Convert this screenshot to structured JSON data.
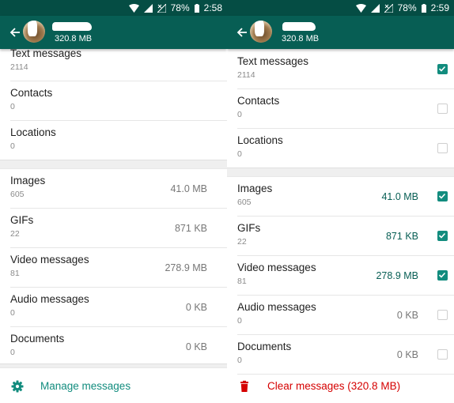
{
  "left_screen": {
    "status_bar": {
      "battery": "78%",
      "time": "2:58"
    },
    "toolbar": {
      "subtitle": "320.8 MB"
    },
    "groups": [
      [
        {
          "title": "Text messages",
          "count": "2114",
          "size": ""
        },
        {
          "title": "Contacts",
          "count": "0",
          "size": ""
        },
        {
          "title": "Locations",
          "count": "0",
          "size": ""
        }
      ],
      [
        {
          "title": "Images",
          "count": "605",
          "size": "41.0 MB"
        },
        {
          "title": "GIFs",
          "count": "22",
          "size": "871 KB"
        },
        {
          "title": "Video messages",
          "count": "81",
          "size": "278.9 MB"
        },
        {
          "title": "Audio messages",
          "count": "0",
          "size": "0 KB"
        },
        {
          "title": "Documents",
          "count": "0",
          "size": "0 KB"
        }
      ]
    ],
    "action": {
      "label": "Manage messages",
      "icon": "gear-icon",
      "color": "#128c7e"
    }
  },
  "right_screen": {
    "status_bar": {
      "battery": "78%",
      "time": "2:59"
    },
    "toolbar": {
      "subtitle": "320.8 MB"
    },
    "groups": [
      [
        {
          "title": "Text messages",
          "count": "2114",
          "size": "",
          "checked": true
        },
        {
          "title": "Contacts",
          "count": "0",
          "size": "",
          "checked": false
        },
        {
          "title": "Locations",
          "count": "0",
          "size": "",
          "checked": false
        }
      ],
      [
        {
          "title": "Images",
          "count": "605",
          "size": "41.0 MB",
          "checked": true
        },
        {
          "title": "GIFs",
          "count": "22",
          "size": "871 KB",
          "checked": true
        },
        {
          "title": "Video messages",
          "count": "81",
          "size": "278.9 MB",
          "checked": true
        },
        {
          "title": "Audio messages",
          "count": "0",
          "size": "0 KB",
          "checked": false
        },
        {
          "title": "Documents",
          "count": "0",
          "size": "0 KB",
          "checked": false
        }
      ]
    ],
    "action": {
      "label": "Clear messages (320.8 MB)",
      "icon": "trash-icon",
      "color": "#d50000"
    }
  },
  "colors": {
    "status_bar": "#054d44",
    "toolbar": "#075e54",
    "accent": "#128c7e",
    "danger": "#d50000"
  }
}
